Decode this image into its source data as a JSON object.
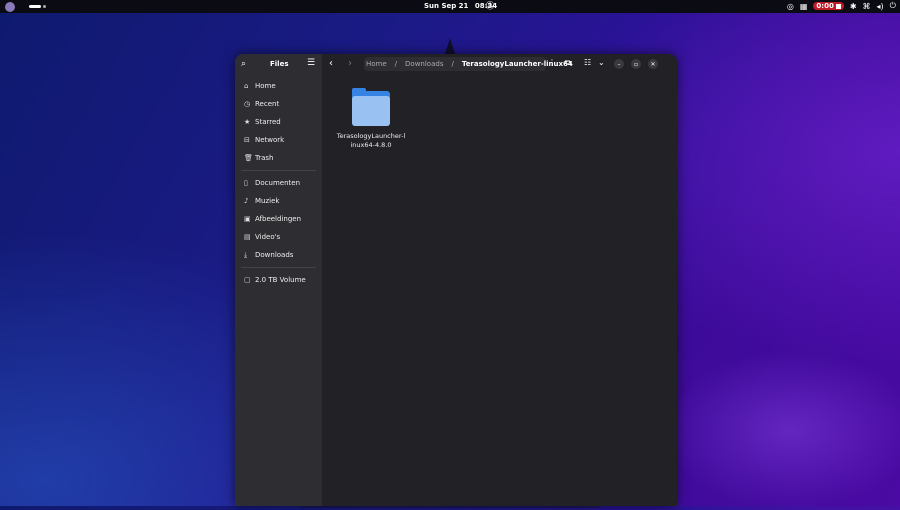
{
  "topbar": {
    "day": "Sun Sep 21",
    "time": "08:34",
    "recording_time": "0:00",
    "icons": [
      "activities-icon",
      "bell-off-icon",
      "steam-icon",
      "screen-record-icon",
      "accessibility-icon",
      "network-icon",
      "volume-icon",
      "power-icon"
    ]
  },
  "window": {
    "title": "Files",
    "breadcrumbs": [
      "Home",
      "Downloads",
      "TerasologyLauncher-linux64"
    ],
    "sidebar": {
      "places": [
        {
          "label": "Home",
          "icon": "home-icon"
        },
        {
          "label": "Recent",
          "icon": "clock-icon"
        },
        {
          "label": "Starred",
          "icon": "star-icon"
        },
        {
          "label": "Network",
          "icon": "network-icon"
        },
        {
          "label": "Trash",
          "icon": "trash-icon"
        }
      ],
      "bookmarks": [
        {
          "label": "Documenten",
          "icon": "document-icon"
        },
        {
          "label": "Muziek",
          "icon": "music-icon"
        },
        {
          "label": "Afbeeldingen",
          "icon": "image-icon"
        },
        {
          "label": "Video's",
          "icon": "video-icon"
        },
        {
          "label": "Downloads",
          "icon": "download-icon"
        }
      ],
      "devices": [
        {
          "label": "2.0 TB Volume",
          "icon": "drive-icon"
        }
      ]
    },
    "files": [
      {
        "name": "TerasologyLauncher-linux64-4.8.0",
        "type": "folder"
      }
    ]
  },
  "colors": {
    "folder_blue": "#3584e4",
    "sidebar_bg": "#2e2e32",
    "main_bg": "#222226"
  }
}
